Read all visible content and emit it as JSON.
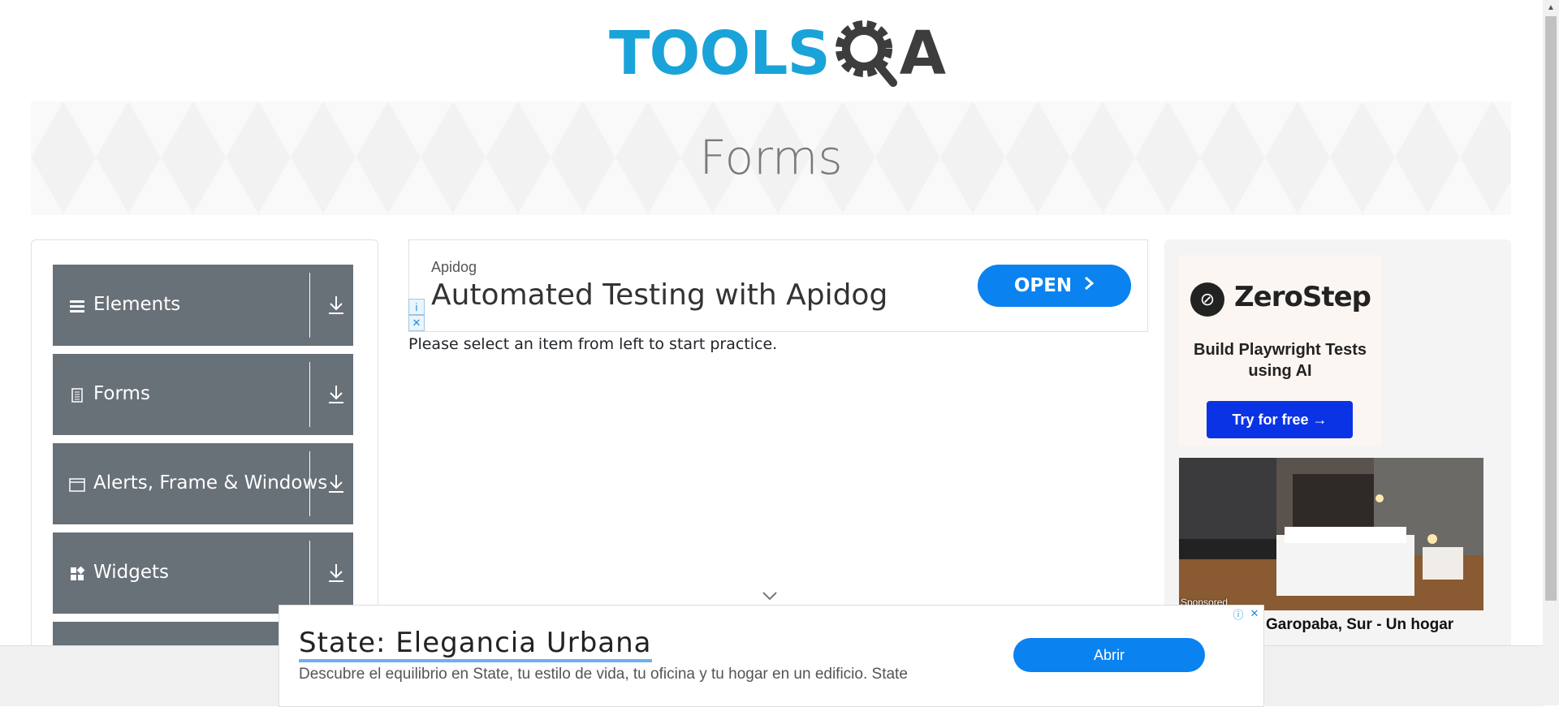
{
  "header": {
    "logo_part1": "TOOLS",
    "logo_part2": "QA"
  },
  "banner": {
    "title": "Forms"
  },
  "sidebar": {
    "groups": [
      {
        "label": "Elements",
        "icon": "hamburger-icon"
      },
      {
        "label": "Forms",
        "icon": "document-icon"
      },
      {
        "label": "Alerts, Frame & Windows",
        "icon": "window-icon"
      },
      {
        "label": "Widgets",
        "icon": "grid-icon"
      }
    ]
  },
  "ad_top": {
    "brand": "Apidog",
    "headline": "Automated Testing with Apidog",
    "button": "OPEN"
  },
  "main": {
    "message": "Please select an item from left to start practice."
  },
  "right_ad": {
    "brand": "ZeroStep",
    "tagline": "Build Playwright Tests using AI",
    "button": "Try for free →",
    "sponsored": "Sponsored",
    "hotel_text": "Garopaba, Sur - Un hogar"
  },
  "bottom_ad": {
    "title": "State: Elegancia Urbana",
    "description": "Descubre el equilibrio en State, tu estilo de vida, tu oficina y tu hogar en un edificio. State",
    "button": "Abrir"
  },
  "colors": {
    "accent": "#0a82ef",
    "sidebar_group": "#687078",
    "logo_blue": "#1aa3d9"
  }
}
